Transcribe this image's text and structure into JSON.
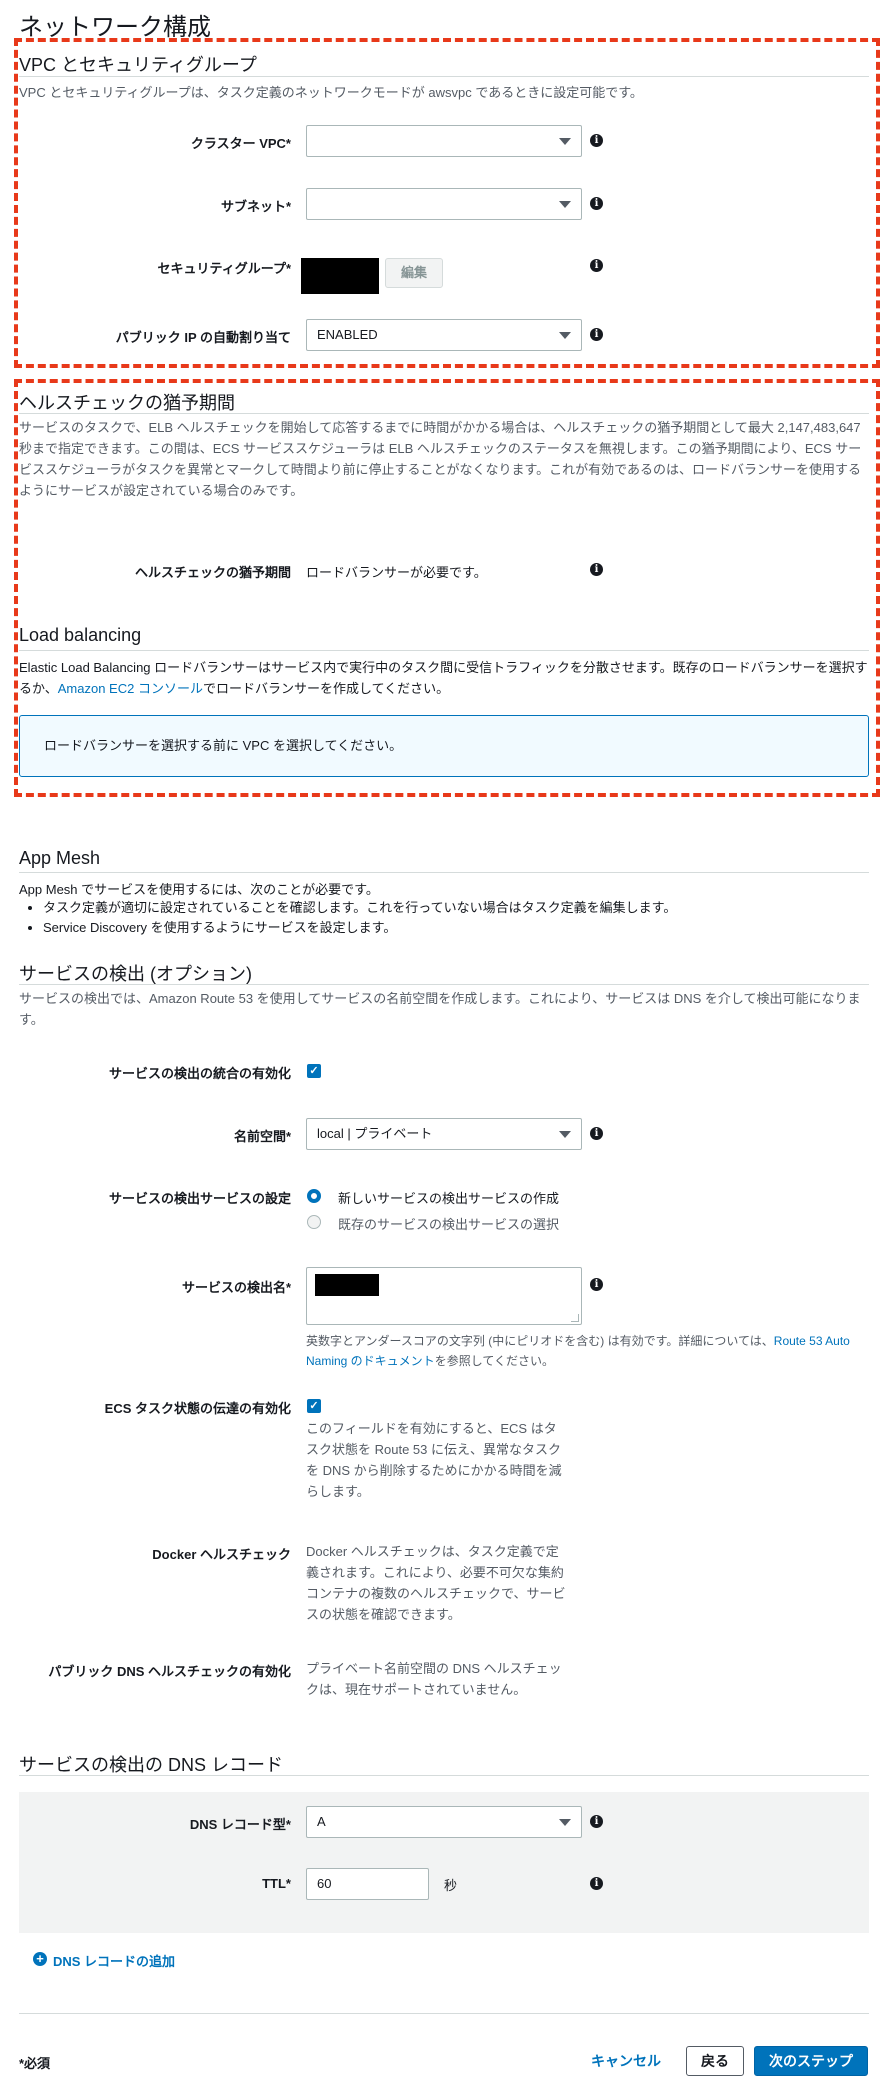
{
  "page": {
    "title": "ネットワーク構成"
  },
  "vpc_section": {
    "title": "VPC とセキュリティグループ",
    "description": "VPC とセキュリティグループは、タスク定義のネットワークモードが awsvpc であるときに設定可能です。",
    "cluster_vpc_label": "クラスター VPC*",
    "cluster_vpc_value": "",
    "subnet_label": "サブネット*",
    "subnet_value": "",
    "security_group_label": "セキュリティグループ*",
    "edit_button": "編集",
    "public_ip_label": "パブリック IP の自動割り当て",
    "public_ip_value": "ENABLED"
  },
  "health_section": {
    "title": "ヘルスチェックの猶予期間",
    "description": "サービスのタスクで、ELB ヘルスチェックを開始して応答するまでに時間がかかる場合は、ヘルスチェックの猶予期間として最大 2,147,483,647 秒まで指定できます。この間は、ECS サービススケジューラは ELB ヘルスチェックのステータスを無視します。この猶予期間により、ECS サービススケジューラがタスクを異常とマークして時間より前に停止することがなくなります。これが有効であるのは、ロードバランサーを使用するようにサービスが設定されている場合のみです。",
    "grace_label": "ヘルスチェックの猶予期間",
    "grace_value": "ロードバランサーが必要です。"
  },
  "lb_section": {
    "title": "Load balancing",
    "description_before": "Elastic Load Balancing ロードバランサーはサービス内で実行中のタスク間に受信トラフィックを分散させます。既存のロードバランサーを選択するか、",
    "link": "Amazon EC2 コンソール",
    "description_after": "でロードバランサーを作成してください。",
    "alert": "ロードバランサーを選択する前に VPC を選択してください。"
  },
  "appmesh_section": {
    "title": "App Mesh",
    "intro": "App Mesh でサービスを使用するには、次のことが必要です。",
    "bullets": [
      "タスク定義が適切に設定されていることを確認します。これを行っていない場合はタスク定義を編集します。",
      "Service Discovery を使用するようにサービスを設定します。"
    ]
  },
  "discovery_section": {
    "title": "サービスの検出 (オプション)",
    "description": "サービスの検出では、Amazon Route 53 を使用してサービスの名前空間を作成します。これにより、サービスは DNS を介して検出可能になります。",
    "enable_label": "サービスの検出の統合の有効化",
    "enable_checked": true,
    "namespace_label": "名前空間*",
    "namespace_value": "local | プライベート",
    "service_setting_label": "サービスの検出サービスの設定",
    "radio_new": "新しいサービスの検出サービスの作成",
    "radio_existing": "既存のサービスの検出サービスの選択",
    "selected_option": "new",
    "name_label": "サービスの検出名*",
    "name_hint_before": "英数字とアンダースコアの文字列 (中にピリオドを含む) は有効です。詳細については、",
    "name_hint_link": "Route 53 Auto Naming のドキュメント",
    "name_hint_after": "を参照してください。",
    "ecs_label": "ECS タスク状態の伝達の有効化",
    "ecs_checked": true,
    "ecs_desc": "このフィールドを有効にすると、ECS はタスク状態を Route 53 に伝え、異常なタスクを DNS から削除するためにかかる時間を減らします。",
    "docker_label": "Docker ヘルスチェック",
    "docker_desc": "Docker ヘルスチェックは、タスク定義で定義されます。これにより、必要不可欠な集約コンテナの複数のヘルスチェックで、サービスの状態を確認できます。",
    "public_dns_label": "パブリック DNS ヘルスチェックの有効化",
    "public_dns_desc": "プライベート名前空間の DNS ヘルスチェックは、現在サポートされていません。"
  },
  "dns_section": {
    "title": "サービスの検出の DNS レコード",
    "record_type_label": "DNS レコード型*",
    "record_type_value": "A",
    "ttl_label": "TTL*",
    "ttl_value": "60",
    "ttl_unit": "秒",
    "add_record": "DNS レコードの追加"
  },
  "footer": {
    "required_note": "*必須",
    "cancel": "キャンセル",
    "back": "戻る",
    "next": "次のステップ"
  },
  "colors": {
    "accent": "#0073bb",
    "dashed_border": "#e8391a"
  }
}
